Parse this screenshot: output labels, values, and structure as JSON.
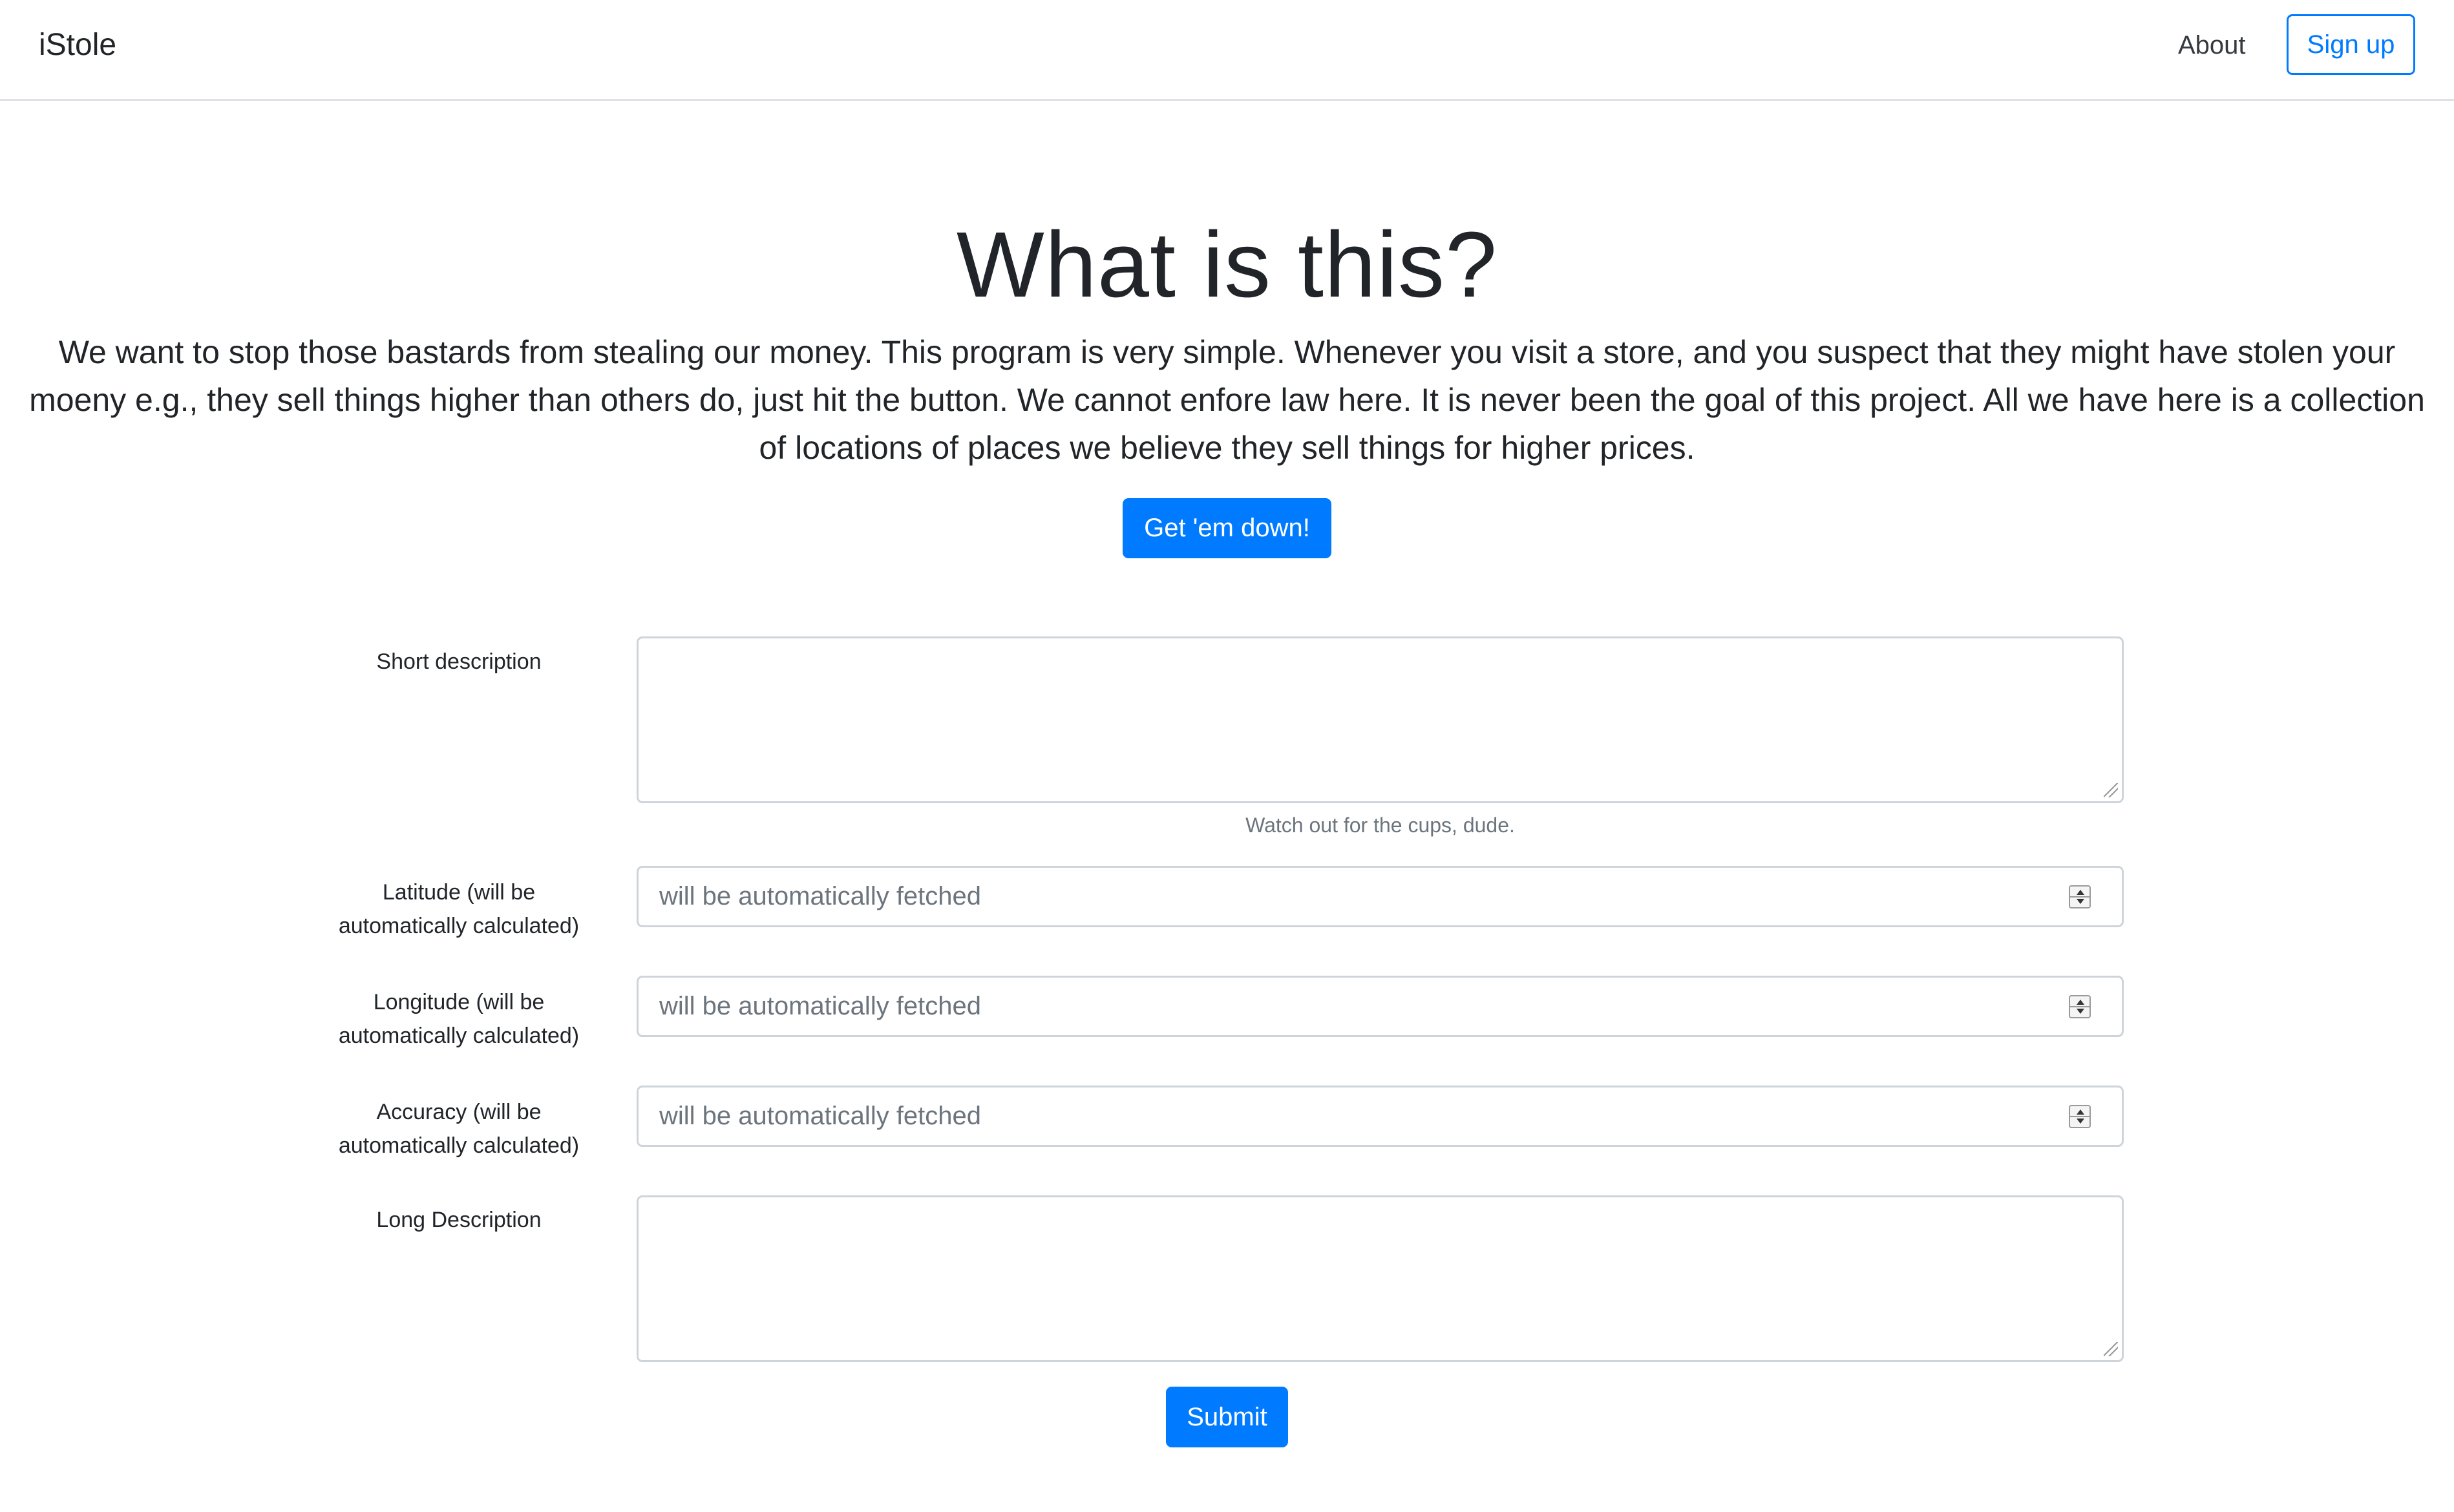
{
  "navbar": {
    "brand": "iStole",
    "about_label": "About",
    "signup_label": "Sign up"
  },
  "hero": {
    "title": "What is this?",
    "lead": "We want to stop those bastards from stealing our money. This program is very simple. Whenever you visit a store, and you suspect that they might have stolen your moeny e.g., they sell things higher than others do, just hit the button. We cannot enfore law here. It is never been the goal of this project. All we have here is a collection of locations of places we believe they sell things for higher prices.",
    "button_label": "Get 'em down!"
  },
  "form": {
    "short_description": {
      "label": "Short description",
      "value": "",
      "help": "Watch out for the cups, dude."
    },
    "latitude": {
      "label": "Latitude (will be automatically calculated)",
      "placeholder": "will be automatically fetched"
    },
    "longitude": {
      "label": "Longitude (will be automatically calculated)",
      "placeholder": "will be automatically fetched"
    },
    "accuracy": {
      "label": "Accuracy (will be automatically calculated)",
      "placeholder": "will be automatically fetched"
    },
    "long_description": {
      "label": "Long Description",
      "value": ""
    },
    "submit_label": "Submit"
  },
  "colors": {
    "primary": "#007bff",
    "text": "#212529",
    "muted": "#6c757d",
    "border": "#ced4da"
  }
}
